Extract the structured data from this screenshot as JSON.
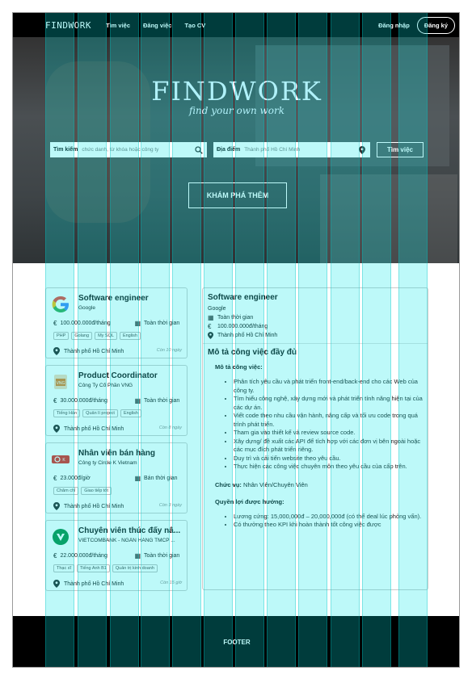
{
  "nav": {
    "logo": "FINDWORK",
    "links": [
      "Tìm việc",
      "Đăng việc",
      "Tạo CV"
    ],
    "login": "Đăng nhập",
    "signup": "Đăng ký"
  },
  "hero": {
    "title": "FINDWORK",
    "subtitle": "find your own work",
    "search_label": "Tìm kiếm",
    "search_placeholder": "chức danh, từ khóa hoặc công ty",
    "location_label": "Địa điểm",
    "location_placeholder": "Thành phố Hồ Chí Minh",
    "search_button": "Tìm việc",
    "explore_button": "KHÁM PHÁ THÊM"
  },
  "jobs": [
    {
      "title": "Software engineer",
      "company": "Google",
      "salary": "100.000.000đ/tháng",
      "type": "Toàn thời gian",
      "tags": [
        "PHP",
        "Golang",
        "My SQL",
        "English"
      ],
      "location": "Thành phố Hồ Chí Minh",
      "ago": "Còn 10 ngày"
    },
    {
      "title": "Product Coordinator",
      "company": "Công Ty Cổ Phần VNG",
      "salary": "30.000.000đ/tháng",
      "type": "Toàn thời gian",
      "tags": [
        "Tiếng Hàn",
        "Quản lí project",
        "English"
      ],
      "location": "Thành phố Hồ Chí Minh",
      "ago": "Còn 8 ngày"
    },
    {
      "title": "Nhân viên bán hàng",
      "company": "Công ty Circle K Vietnam",
      "salary": "23.000đ/giờ",
      "type": "Bán thời gian",
      "tags": [
        "Chăm chỉ",
        "Giao tiếp tốt"
      ],
      "location": "Thành phố Hồ Chí Minh",
      "ago": "Còn 3 ngày"
    },
    {
      "title": "Chuyên viên thúc đẩy nâ...",
      "company": "VIETCOMBANK - NGÂN HÀNG TMCP ...",
      "salary": "22.000.000đ/tháng",
      "type": "Toàn thời gian",
      "tags": [
        "Thạc sĩ",
        "Tiếng Anh B1",
        "Quản trị kinh doanh"
      ],
      "location": "Thành phố Hồ Chí Minh",
      "ago": "Còn 15 giờ"
    }
  ],
  "detail": {
    "title": "Software engineer",
    "company": "Google",
    "type": "Toàn thời gian",
    "salary": "100.000.000đ/tháng",
    "location": "Thành phố Hồ Chí Minh",
    "section_title": "Mô tả công việc đầy đủ",
    "desc_heading": "Mô tả công việc:",
    "desc_items": [
      "Phân tích yêu cầu và phát triển front-end/back-end cho các Web của công ty.",
      "Tìm hiểu công nghệ, xây dựng mới và phát triển tính năng hiện tại của các dự án.",
      "Viết code theo nhu cầu vận hành, nâng cấp và tối ưu code trong quá trình phát triển.",
      "Tham gia vào thiết kế và review source code.",
      "Xây dựng/ đề xuất các API để tích hợp với các đơn vị bên ngoài hoặc các mục đích phát triển riêng.",
      "Duy trì và cải tiến website theo yêu cầu.",
      "Thực hiện các công việc chuyên môn theo yêu cầu của cấp trên."
    ],
    "role_label": "Chức vụ:",
    "role_value": "Nhân Viên/Chuyên Viên",
    "benefits_heading": "Quyền lợi được hưởng:",
    "benefits_items": [
      "Lương cứng: 15,000,000đ – 20,000,000đ (có thể deal lúc phỏng vấn).",
      "Có thưởng theo KPI khi hoàn thành tốt công việc được"
    ]
  },
  "footer": {
    "label": "FOOTER"
  }
}
